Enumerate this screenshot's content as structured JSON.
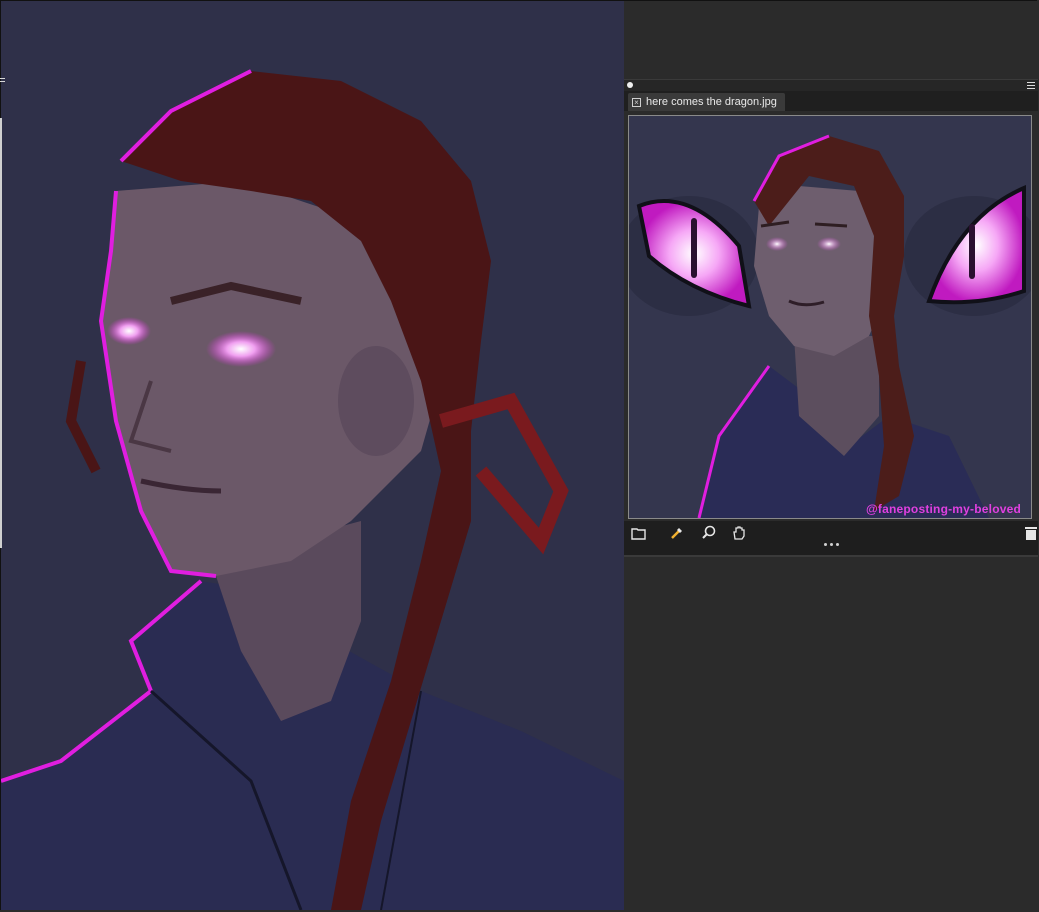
{
  "reference_panel": {
    "tab_title": "here comes the dragon.jpg",
    "watermark": "@faneposting-my-beloved"
  },
  "toolbar": {
    "icons": [
      "open-folder-icon",
      "eyedropper-icon",
      "zoom-icon",
      "hand-pan-icon",
      "trash-icon",
      "more-options-icon"
    ]
  },
  "colors": {
    "canvas_bg": "#2f3049",
    "panel_bg": "#2b2b2b",
    "glow": "#e01ee0",
    "hair": "#5a1a1a",
    "skin": "#6e5a68"
  }
}
